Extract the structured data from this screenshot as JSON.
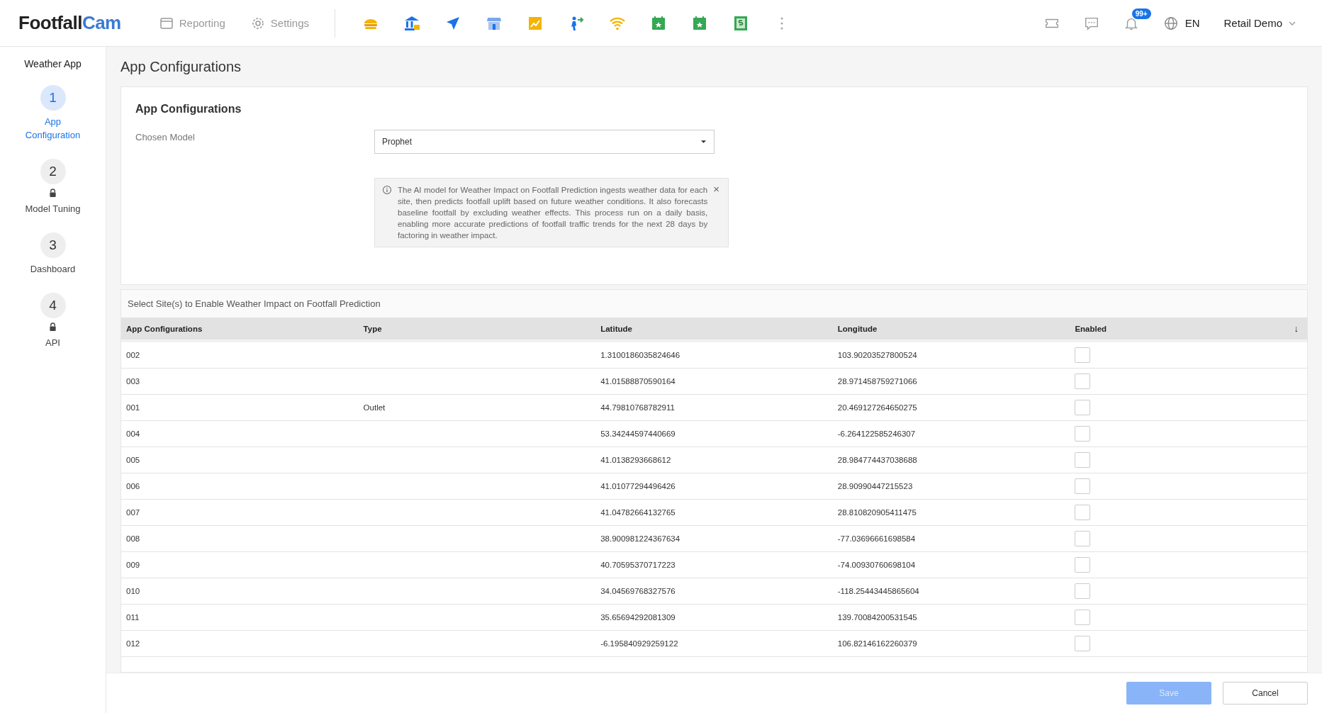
{
  "header": {
    "logo": {
      "part_1": "Footfall",
      "part_2": "Cam"
    },
    "nav": [
      {
        "label": "Reporting",
        "kind": "calendar"
      },
      {
        "label": "Settings",
        "kind": "gear"
      }
    ],
    "apps": [
      {
        "kind": "burger"
      },
      {
        "kind": "bank"
      },
      {
        "kind": "plane"
      },
      {
        "kind": "store"
      },
      {
        "kind": "chart"
      },
      {
        "kind": "people"
      },
      {
        "kind": "wifi"
      },
      {
        "kind": "calendar"
      },
      {
        "kind": "calendar"
      },
      {
        "kind": "money"
      },
      {
        "kind": "more"
      }
    ],
    "notification_badge": "99+",
    "language": "EN",
    "user": "Retail Demo"
  },
  "sidebar": {
    "title": "Weather App",
    "steps": [
      {
        "number": "1",
        "label": "App Configuration",
        "selected": true,
        "locked": false
      },
      {
        "number": "2",
        "label": "Model Tuning",
        "selected": false,
        "locked": true
      },
      {
        "number": "3",
        "label": "Dashboard",
        "selected": false,
        "locked": false
      },
      {
        "number": "4",
        "label": "API",
        "selected": false,
        "locked": true
      }
    ]
  },
  "page_title": "App Configurations",
  "card": {
    "title": "App Configurations",
    "field_label": "Chosen Model",
    "field_value": "Prophet",
    "info": {
      "text": "The AI model for Weather Impact on Footfall Prediction ingests weather data for each site, then predicts footfall uplift based on future weather conditions. It also forecasts baseline footfall by excluding weather effects. This process run on a daily basis, enabling more accurate predictions of footfall traffic trends for the next 28 days by factoring in weather impact.",
      "close": "×"
    }
  },
  "table": {
    "caption": "Select Site(s) to Enable Weather Impact on Footfall Prediction",
    "columns": [
      "App Configurations",
      "Type",
      "Latitude",
      "Longitude",
      "Enabled"
    ],
    "sort_indicator": "↓",
    "rows": [
      {
        "site": "002",
        "type": "",
        "latitude": "1.3100186035824646",
        "longitude": "103.90203527800524",
        "enabled": false
      },
      {
        "site": "003",
        "type": "",
        "latitude": "41.01588870590164",
        "longitude": "28.971458759271066",
        "enabled": false
      },
      {
        "site": "001",
        "type": "Outlet",
        "latitude": "44.79810768782911",
        "longitude": "20.469127264650275",
        "enabled": false
      },
      {
        "site": "004",
        "type": "",
        "latitude": "53.34244597440669",
        "longitude": "-6.264122585246307",
        "enabled": false
      },
      {
        "site": "005",
        "type": "",
        "latitude": "41.0138293668612",
        "longitude": "28.984774437038688",
        "enabled": false
      },
      {
        "site": "006",
        "type": "",
        "latitude": "41.01077294496426",
        "longitude": "28.90990447215523",
        "enabled": false
      },
      {
        "site": "007",
        "type": "",
        "latitude": "41.04782664132765",
        "longitude": "28.810820905411475",
        "enabled": false
      },
      {
        "site": "008",
        "type": "",
        "latitude": "38.900981224367634",
        "longitude": "-77.03696661698584",
        "enabled": false
      },
      {
        "site": "009",
        "type": "",
        "latitude": "40.70595370717223",
        "longitude": "-74.00930760698104",
        "enabled": false
      },
      {
        "site": "010",
        "type": "",
        "latitude": "34.04569768327576",
        "longitude": "-118.25443445865604",
        "enabled": false
      },
      {
        "site": "011",
        "type": "",
        "latitude": "35.65694292081309",
        "longitude": "139.70084200531545",
        "enabled": false
      },
      {
        "site": "012",
        "type": "",
        "latitude": "-6.195840929259122",
        "longitude": "106.82146162260379",
        "enabled": false
      }
    ]
  },
  "footer": {
    "buttons": [
      {
        "label": "Save",
        "kind": "primary",
        "disabled": true
      },
      {
        "label": "Cancel",
        "kind": "default",
        "disabled": false
      }
    ]
  }
}
